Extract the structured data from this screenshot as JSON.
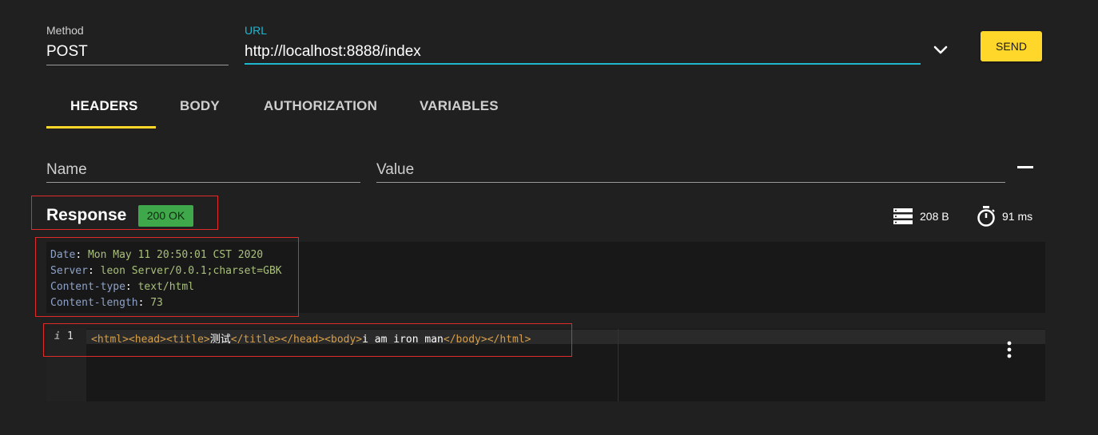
{
  "request": {
    "method_label": "Method",
    "method_value": "POST",
    "url_label": "URL",
    "url_value": "http://localhost:8888/index",
    "send_label": "SEND",
    "accent_color": "#00bcd4"
  },
  "tabs": [
    {
      "label": "HEADERS",
      "active": true
    },
    {
      "label": "BODY",
      "active": false
    },
    {
      "label": "AUTHORIZATION",
      "active": false
    },
    {
      "label": "VARIABLES",
      "active": false
    }
  ],
  "headers_editor": {
    "name_placeholder": "Name",
    "value_placeholder": "Value"
  },
  "response": {
    "title": "Response",
    "status": "200 OK",
    "status_color": "#3ea84a",
    "size": "208 B",
    "time": "91 ms",
    "headers": [
      {
        "key": "Date",
        "sep": ":",
        "value": "Mon May 11 20:50:01 CST 2020"
      },
      {
        "key": "Server",
        "sep": ":",
        "value": "leon Server/0.0.1;charset=GBK"
      },
      {
        "key": "Content-type",
        "sep": ":",
        "value": "text/html"
      },
      {
        "key": "Content-length",
        "sep": ":",
        "value": "73"
      }
    ],
    "body": {
      "line_number": "1",
      "info_icon": "info-icon",
      "segments": [
        {
          "kind": "tag",
          "text": "<html>"
        },
        {
          "kind": "tag",
          "text": "<head>"
        },
        {
          "kind": "tag",
          "text": "<title>"
        },
        {
          "kind": "txt",
          "text": "测试"
        },
        {
          "kind": "tag",
          "text": "</title>"
        },
        {
          "kind": "tag",
          "text": "</head>"
        },
        {
          "kind": "tag",
          "text": "<body>"
        },
        {
          "kind": "txt",
          "text": "i am iron man"
        },
        {
          "kind": "tag",
          "text": "</body>"
        },
        {
          "kind": "tag",
          "text": "</html>"
        }
      ]
    }
  }
}
